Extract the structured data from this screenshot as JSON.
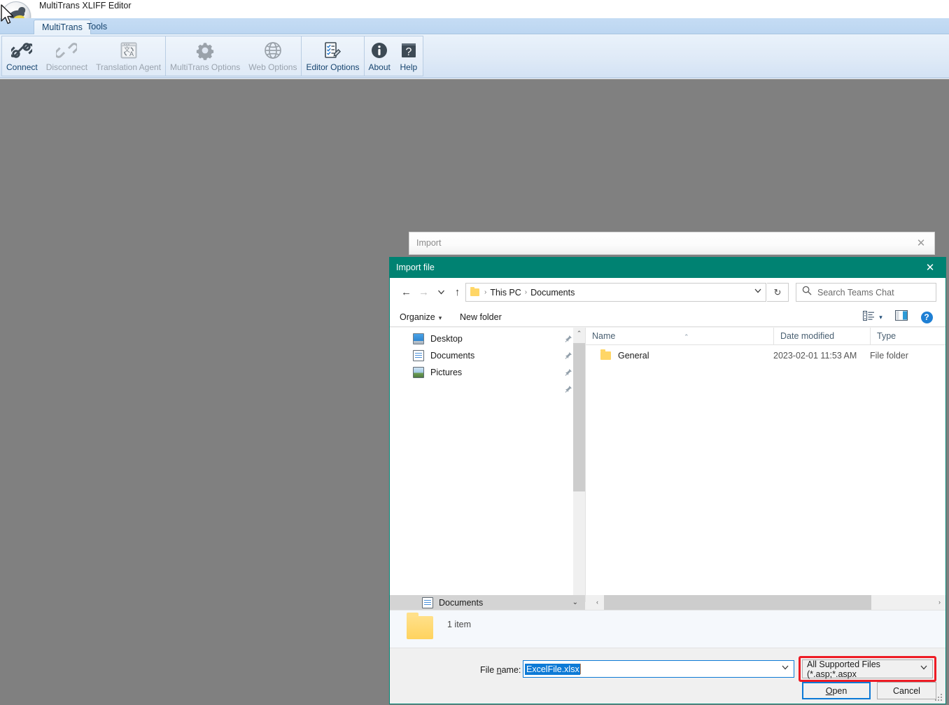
{
  "app": {
    "title": "MultiTrans XLIFF Editor",
    "logo_icon": "multitrans-logo-icon",
    "tabs": [
      {
        "label": "MultiTrans",
        "active": true
      },
      {
        "label": "Tools",
        "active": false
      }
    ],
    "ribbon_groups": [
      {
        "buttons": [
          {
            "label": "Connect",
            "icon": "connect-link-icon",
            "enabled": true
          },
          {
            "label": "Disconnect",
            "icon": "disconnect-link-icon",
            "enabled": false
          },
          {
            "label": "Translation Agent",
            "icon": "translation-agent-icon",
            "enabled": false
          }
        ]
      },
      {
        "buttons": [
          {
            "label": "MultiTrans Options",
            "icon": "gear-icon",
            "enabled": false
          },
          {
            "label": "Web Options",
            "icon": "globe-icon",
            "enabled": false
          }
        ]
      },
      {
        "buttons": [
          {
            "label": "Editor Options",
            "icon": "checklist-pencil-icon",
            "enabled": true
          }
        ]
      },
      {
        "buttons": [
          {
            "label": "About",
            "icon": "info-icon",
            "enabled": true
          },
          {
            "label": "Help",
            "icon": "question-book-icon",
            "enabled": true
          }
        ]
      }
    ]
  },
  "import_window": {
    "title": "Import",
    "close_icon": "close-icon",
    "close_label": "✕"
  },
  "dialog": {
    "title": "Import file",
    "close_icon": "close-icon",
    "close_label": "✕",
    "accent_color": "#008272",
    "nav": {
      "back_icon": "arrow-left-icon",
      "back_glyph": "←",
      "forward_icon": "arrow-right-icon",
      "forward_glyph": "→",
      "recent_icon": "chevron-down-icon",
      "recent_glyph": "⌄",
      "up_icon": "arrow-up-icon",
      "up_glyph": "↑",
      "refresh_icon": "refresh-icon",
      "refresh_glyph": "↻"
    },
    "address_bar": {
      "folder_icon": "folder-icon",
      "crumbs": [
        "This PC",
        "Documents"
      ],
      "separator": "›",
      "dropdown_icon": "chevron-down-icon",
      "dropdown_glyph": "⌄"
    },
    "search": {
      "icon": "search-icon",
      "placeholder": "Search Teams Chat",
      "value": ""
    },
    "command_bar": {
      "organize_label": "Organize",
      "organize_caret": "▾",
      "new_folder_label": "New folder",
      "view_icon": "view-layout-icon",
      "view_caret": "▾",
      "preview_pane_icon": "preview-pane-icon",
      "help_icon": "help-icon",
      "help_glyph": "?"
    },
    "nav_pane": {
      "items": [
        {
          "label": "Desktop",
          "icon": "desktop-icon",
          "pinned": true
        },
        {
          "label": "Documents",
          "icon": "documents-icon",
          "pinned": true
        },
        {
          "label": "Pictures",
          "icon": "pictures-icon",
          "pinned": true
        },
        {
          "label": "",
          "icon": "pin-icon",
          "pinned": true
        }
      ],
      "pin_glyph": "📌",
      "bottom_section": {
        "label": "Documents",
        "icon": "documents-icon",
        "caret": "⌄"
      },
      "scrollbar": {
        "up_glyph": "⌃",
        "down_glyph": "⌄"
      }
    },
    "file_list": {
      "columns": [
        "Name",
        "Date modified",
        "Type"
      ],
      "sort_indicator": "⌃",
      "sort_column": "Name",
      "rows": [
        {
          "name": "General",
          "icon": "folder-icon",
          "date_modified": "2023-02-01 11:53 AM",
          "type": "File folder"
        }
      ],
      "hscroll": {
        "left_glyph": "‹",
        "right_glyph": "›"
      }
    },
    "details_pane": {
      "icon": "folder-icon",
      "text": "1 item"
    },
    "footer": {
      "filename_label_pre": "File ",
      "filename_label_accel": "n",
      "filename_label_post": "ame:",
      "filename_value": "ExcelFile.xlsx",
      "filename_selected": true,
      "filename_dropdown_icon": "chevron-down-icon",
      "filename_dropdown_glyph": "⌄",
      "filter_value": "All Supported Files (*.asp;*.aspx",
      "filter_dropdown_icon": "chevron-down-icon",
      "filter_dropdown_glyph": "⌄",
      "filter_highlight_color": "#ee1c25",
      "open_label_pre": "",
      "open_label_accel": "O",
      "open_label_post": "pen",
      "cancel_label": "Cancel"
    }
  },
  "cursor": {
    "icon": "mouse-pointer-icon"
  }
}
